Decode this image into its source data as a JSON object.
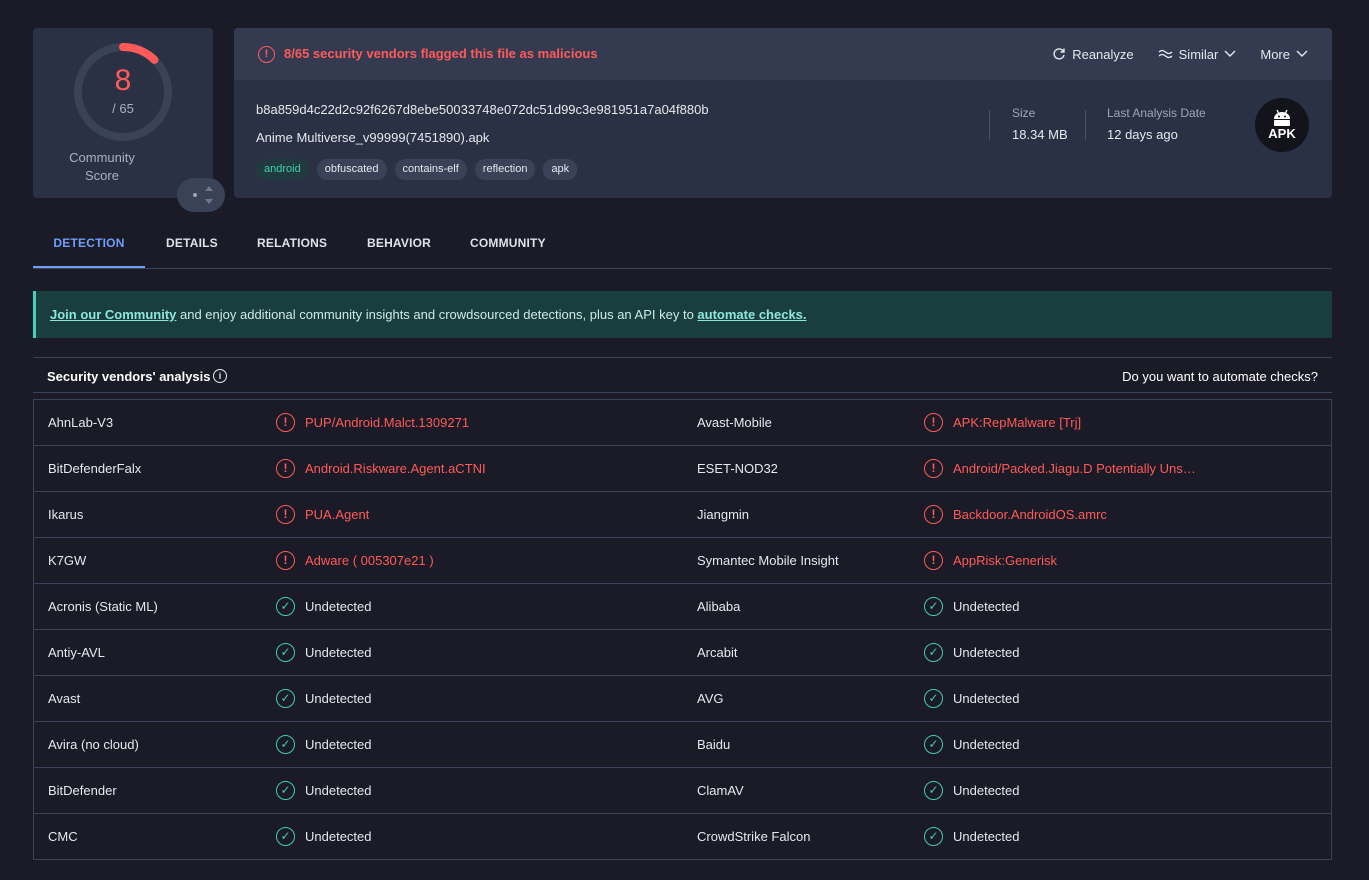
{
  "score": {
    "detected": "8",
    "total": "/ 65",
    "community_label_1": "Community",
    "community_label_2": "Score"
  },
  "alert": {
    "text": "8/65 security vendors flagged this file as malicious",
    "color": "#ff5a5a"
  },
  "actions": {
    "reanalyze": "Reanalyze",
    "similar": "Similar",
    "more": "More"
  },
  "file": {
    "hash": "b8a859d4c22d2c92f6267d8ebe50033748e072dc51d99c3e981951a7a04f880b",
    "name": "Anime Multiverse_v99999(7451890).apk",
    "tags": [
      "android",
      "obfuscated",
      "contains-elf",
      "reflection",
      "apk"
    ],
    "size_label": "Size",
    "size_value": "18.34 MB",
    "date_label": "Last Analysis Date",
    "date_value": "12 days ago",
    "type_badge": "APK"
  },
  "tabs": [
    "DETECTION",
    "DETAILS",
    "RELATIONS",
    "BEHAVIOR",
    "COMMUNITY"
  ],
  "banner": {
    "link1": "Join our Community",
    "middle": " and enjoy additional community insights and crowdsourced detections, plus an API key to ",
    "link2": "automate checks."
  },
  "section": {
    "title": "Security vendors' analysis",
    "right": "Do you want to automate checks?"
  },
  "vendors": [
    {
      "left_name": "AhnLab-V3",
      "left_result": "PUP/Android.Malct.1309271",
      "left_status": "bad",
      "right_name": "Avast-Mobile",
      "right_result": "APK:RepMalware [Trj]",
      "right_status": "bad"
    },
    {
      "left_name": "BitDefenderFalx",
      "left_result": "Android.Riskware.Agent.aCTNI",
      "left_status": "bad",
      "right_name": "ESET-NOD32",
      "right_result": "Android/Packed.Jiagu.D Potentially Uns…",
      "right_status": "bad"
    },
    {
      "left_name": "Ikarus",
      "left_result": "PUA.Agent",
      "left_status": "bad",
      "right_name": "Jiangmin",
      "right_result": "Backdoor.AndroidOS.amrc",
      "right_status": "bad"
    },
    {
      "left_name": "K7GW",
      "left_result": "Adware ( 005307e21 )",
      "left_status": "bad",
      "right_name": "Symantec Mobile Insight",
      "right_result": "AppRisk:Generisk",
      "right_status": "bad"
    },
    {
      "left_name": "Acronis (Static ML)",
      "left_result": "Undetected",
      "left_status": "ok",
      "right_name": "Alibaba",
      "right_result": "Undetected",
      "right_status": "ok"
    },
    {
      "left_name": "Antiy-AVL",
      "left_result": "Undetected",
      "left_status": "ok",
      "right_name": "Arcabit",
      "right_result": "Undetected",
      "right_status": "ok"
    },
    {
      "left_name": "Avast",
      "left_result": "Undetected",
      "left_status": "ok",
      "right_name": "AVG",
      "right_result": "Undetected",
      "right_status": "ok"
    },
    {
      "left_name": "Avira (no cloud)",
      "left_result": "Undetected",
      "left_status": "ok",
      "right_name": "Baidu",
      "right_result": "Undetected",
      "right_status": "ok"
    },
    {
      "left_name": "BitDefender",
      "left_result": "Undetected",
      "left_status": "ok",
      "right_name": "ClamAV",
      "right_result": "Undetected",
      "right_status": "ok"
    },
    {
      "left_name": "CMC",
      "left_result": "Undetected",
      "left_status": "ok",
      "right_name": "CrowdStrike Falcon",
      "right_result": "Undetected",
      "right_status": "ok"
    }
  ],
  "icons": {
    "alert": "alert-circle-icon",
    "detected": "alert-circle-icon",
    "undetected": "check-circle-icon",
    "reanalyze": "refresh-icon",
    "similar": "similar-icon",
    "dropdown": "chevron-down-icon",
    "info": "info-icon",
    "file_type": "android-icon"
  }
}
